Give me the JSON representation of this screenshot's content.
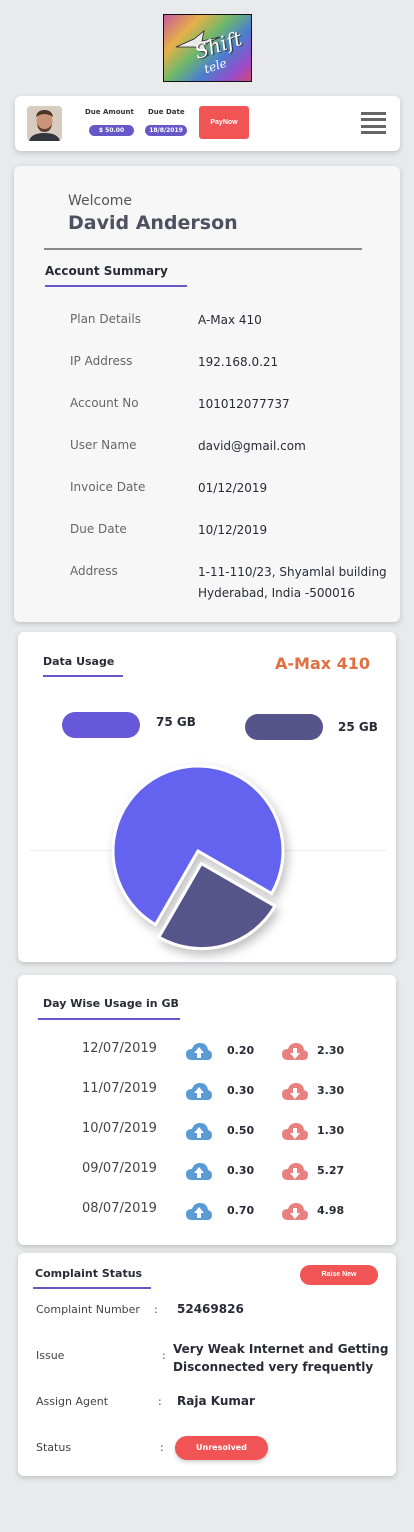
{
  "header": {
    "due_amount_label": "Due Amount",
    "due_amount": "$ 50.00",
    "due_date_label": "Due Date",
    "due_date": "18/8/2019",
    "pay_label": "PayNow",
    "logo_text_1": "Shift",
    "logo_text_2": "tele"
  },
  "account": {
    "welcome": "Welcome",
    "name": "David Anderson",
    "summary_title": "Account Summary",
    "rows": [
      {
        "label": "Plan Details",
        "value": "A-Max 410"
      },
      {
        "label": "IP Address",
        "value": "192.168.0.21"
      },
      {
        "label": "Account No",
        "value": "101012077737"
      },
      {
        "label": "User Name",
        "value": "david@gmail.com"
      },
      {
        "label": "Invoice Date",
        "value": "01/12/2019"
      },
      {
        "label": "Due Date",
        "value": "10/12/2019"
      },
      {
        "label": "Address",
        "value": "1-11-110/23, Shyamlal building",
        "value2": "Hyderabad, India -500016"
      }
    ]
  },
  "usage": {
    "title": "Data Usage",
    "plan": "A-Max 410",
    "legend": [
      {
        "value": "75 GB",
        "color": "#6658d8"
      },
      {
        "value": "25 GB",
        "color": "#54548a"
      }
    ]
  },
  "chart_data": {
    "type": "pie",
    "title": "Data Usage",
    "slices": [
      {
        "label": "75 GB",
        "value": 75,
        "color": "#6464f0"
      },
      {
        "label": "25 GB",
        "value": 25,
        "color": "#54548a"
      }
    ]
  },
  "daywise": {
    "title": "Day Wise Usage in GB",
    "rows": [
      {
        "date": "12/07/2019",
        "up": "0.20",
        "down": "2.30"
      },
      {
        "date": "11/07/2019",
        "up": "0.30",
        "down": "3.30"
      },
      {
        "date": "10/07/2019",
        "up": "0.50",
        "down": "1.30"
      },
      {
        "date": "09/07/2019",
        "up": "0.30",
        "down": "5.27"
      },
      {
        "date": "08/07/2019",
        "up": "0.70",
        "down": "4.98"
      }
    ],
    "up_color": "#5b9bd5",
    "down_color": "#e88080"
  },
  "complaint": {
    "title": "Complaint Status",
    "raise_label": "Raise New",
    "number_label": "Complaint Number",
    "number": "52469826",
    "issue_label": "Issue",
    "issue_1": "Very Weak Internet and Getting",
    "issue_2": "Disconnected very frequently",
    "agent_label": "Assign Agent",
    "agent": "Raja Kumar",
    "status_label": "Status",
    "status": "Unresolved"
  }
}
